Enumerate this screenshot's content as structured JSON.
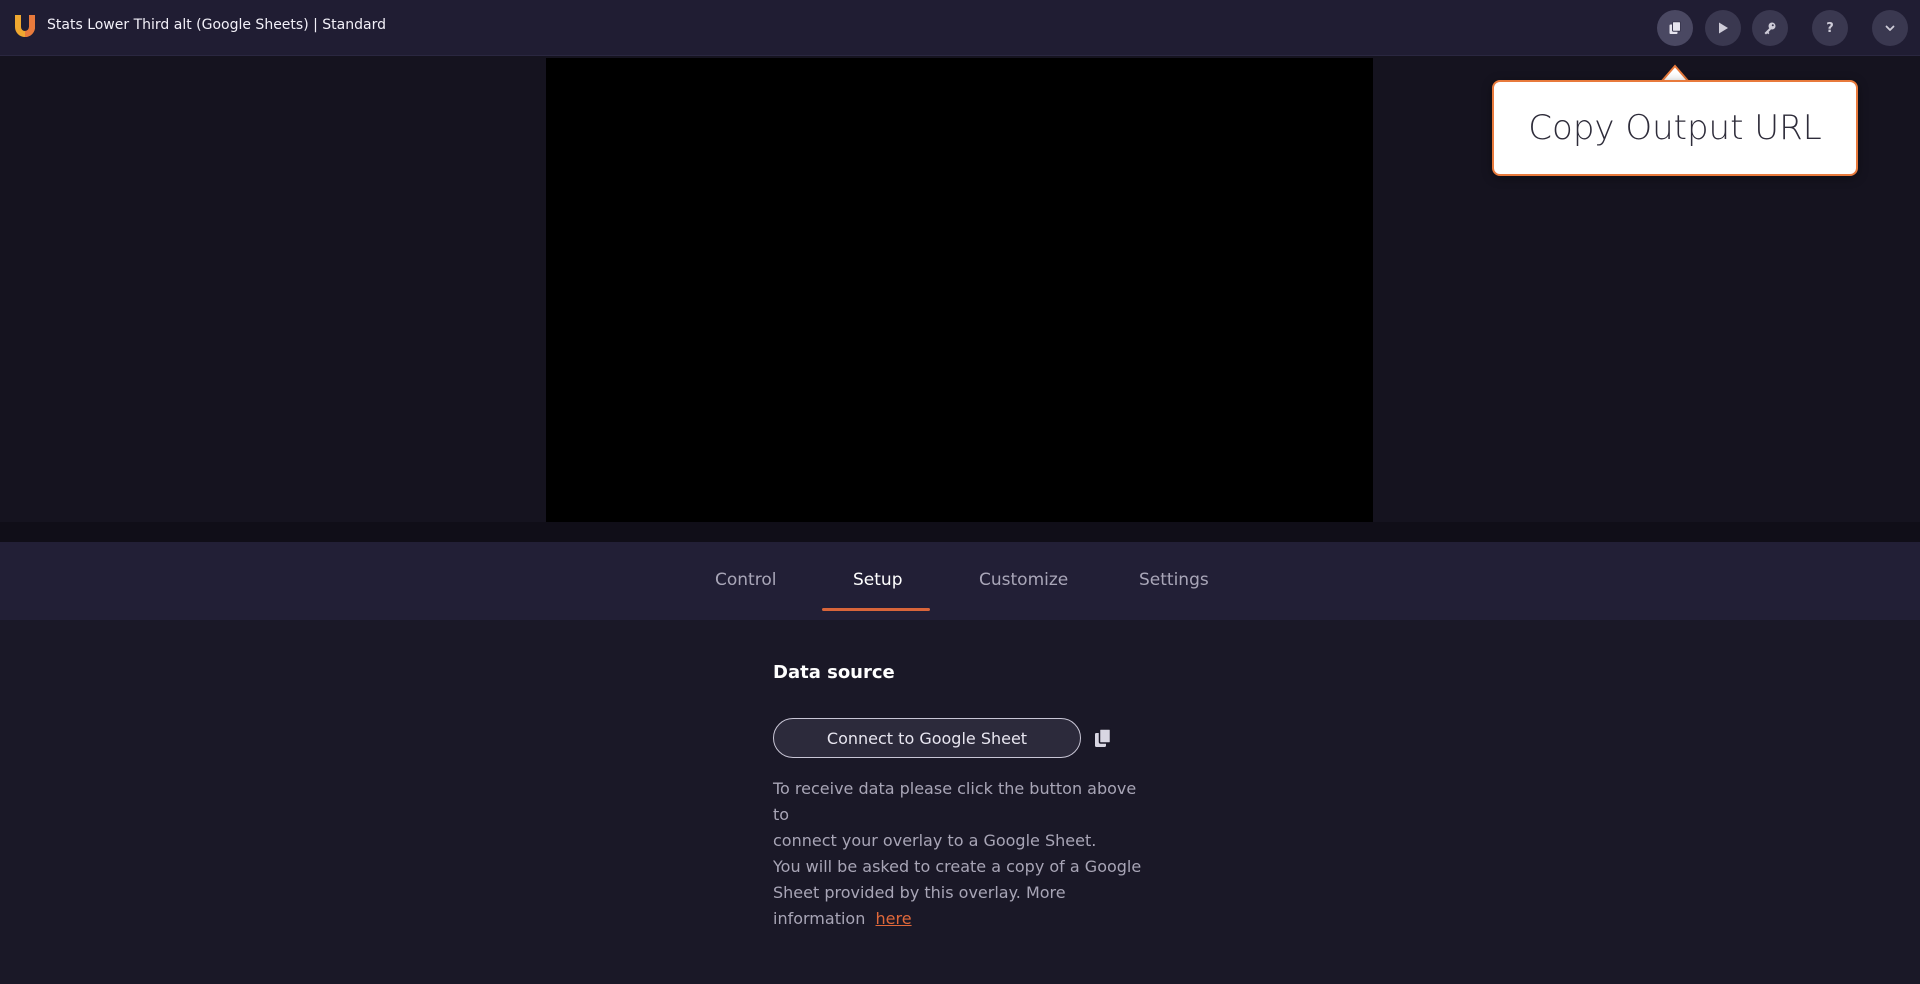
{
  "app": {
    "title": "Stats Lower Third alt (Google Sheets) | Standard",
    "logo_letter": "U",
    "accent_color": "#e87a3c",
    "logo_color": "#f0a830"
  },
  "toolbar": {
    "buttons": [
      {
        "icon": "copy-icon",
        "label": "Copy Output URL"
      },
      {
        "icon": "play-icon",
        "label": "Play"
      },
      {
        "icon": "key-icon",
        "label": "Key"
      },
      {
        "icon": "help-icon",
        "label": "?"
      },
      {
        "icon": "chevron-down-icon",
        "label": "Menu"
      }
    ]
  },
  "tooltip": {
    "text": "Copy Output URL"
  },
  "tabs": [
    {
      "label": "Control",
      "active": false
    },
    {
      "label": "Setup",
      "active": true
    },
    {
      "label": "Customize",
      "active": false
    },
    {
      "label": "Settings",
      "active": false
    }
  ],
  "setup": {
    "section_title": "Data source",
    "connect_button": "Connect to Google Sheet",
    "paragraph1_line1": "To receive data please click the button above to",
    "paragraph1_line2": "connect your overlay to a Google Sheet.",
    "paragraph2_line1": "You will be asked to create a copy of a Google",
    "paragraph2_line2": "Sheet provided by this overlay. More",
    "paragraph2_line3": "information",
    "link_text": "here"
  }
}
